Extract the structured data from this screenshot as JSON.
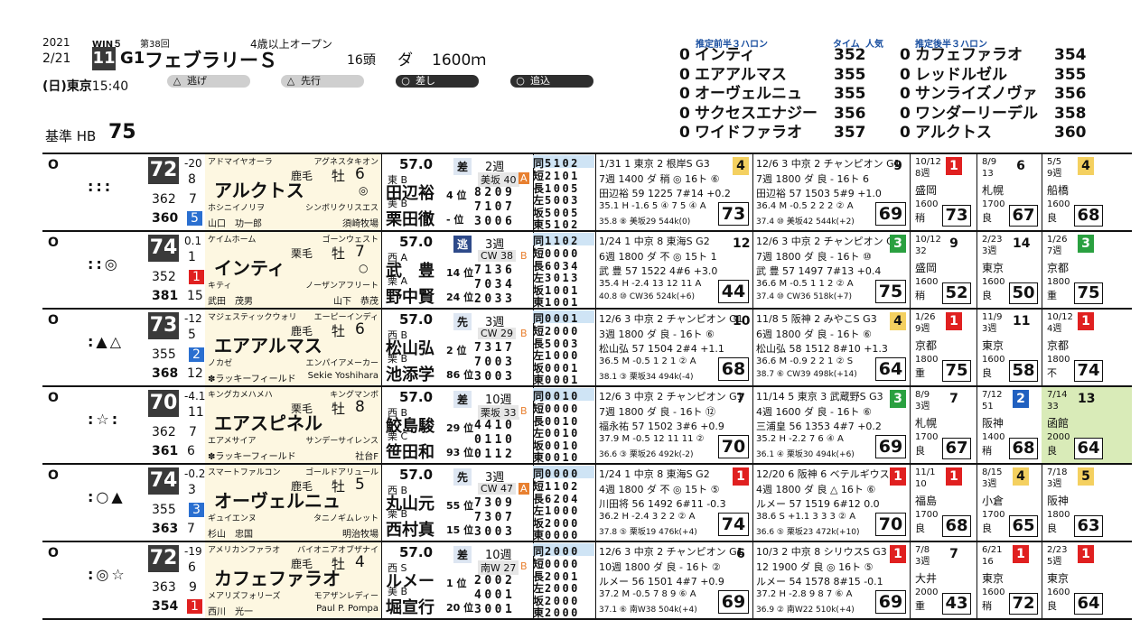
{
  "header": {
    "year": "2021",
    "date": "2/21",
    "day": "(日)",
    "venue": "東京",
    "time": "15:40",
    "win5": "WIN５",
    "kai": "第38回",
    "race_no": "11",
    "grade": "G1",
    "race_name": "フェブラリーＳ",
    "condition": "4歳以上オープン",
    "heads": "16頭",
    "surface": "ダ",
    "distance": "1600ｍ",
    "styles": [
      {
        "mark": "△",
        "label": "逃げ",
        "dark": false
      },
      {
        "mark": "△",
        "label": "先行",
        "dark": false
      },
      {
        "mark": "○",
        "label": "差し",
        "dark": true
      },
      {
        "mark": "○",
        "label": "追込",
        "dark": true
      }
    ],
    "base_label": "基準 HB",
    "base_value": "75"
  },
  "pre3f": {
    "title": "推定前半３ハロン",
    "col_time": "タイム",
    "col_pop": "人気",
    "items": [
      {
        "num": "0",
        "name": "インティ",
        "time": "352"
      },
      {
        "num": "0",
        "name": "エアアルマス",
        "time": "355"
      },
      {
        "num": "0",
        "name": "オーヴェルニュ",
        "time": "355"
      },
      {
        "num": "0",
        "name": "サクセスエナジー",
        "time": "356"
      },
      {
        "num": "0",
        "name": "ワイドファラオ",
        "time": "357"
      }
    ]
  },
  "post3f": {
    "title": "推定後半３ハロン",
    "items": [
      {
        "num": "0",
        "name": "カフェファラオ",
        "time": "354"
      },
      {
        "num": "0",
        "name": "レッドルゼル",
        "time": "355"
      },
      {
        "num": "0",
        "name": "サンライズノヴァ",
        "time": "356"
      },
      {
        "num": "0",
        "name": "ワンダーリーデル",
        "time": "358"
      },
      {
        "num": "0",
        "name": "アルクトス",
        "time": "360"
      }
    ]
  },
  "horses": [
    {
      "mark": "O",
      "pred": ":::",
      "idx": "72",
      "chg": "-20",
      "rank": "8",
      "hb1": "362",
      "hb1r": "7",
      "hb2": "360",
      "hb2r": "5",
      "hb2c": "blue",
      "sire": "アドマイヤオーラ",
      "bms": "アグネスタキオン",
      "coat": "鹿毛",
      "sex": "牡",
      "age": "6",
      "name": "アルクトス",
      "sym": "◎",
      "dam": "ホシニイノリヲ",
      "dam_sire": "シンボリクリスエス",
      "trainer": "山口　功一郎",
      "owner": "須崎牧場",
      "weight": "57.0",
      "style": "差",
      "style_hi": false,
      "j1_tag": "東 B",
      "j1": "田辺裕",
      "j1_rank": "4 位",
      "j2_tag": "美 B",
      "j2": "栗田徹",
      "j2_rank": "- 位",
      "weeks": "2週",
      "course": "美坂 40",
      "course_tag": "A",
      "d1": "8209",
      "d2": "7107",
      "d3": "3006",
      "stats": [
        [
          "同",
          "5102"
        ],
        [
          "短",
          "2101"
        ],
        [
          "長",
          "1005"
        ],
        [
          "左",
          "5003"
        ],
        [
          "坂",
          "5005"
        ],
        [
          "東",
          "5102"
        ]
      ],
      "r1": {
        "l1": "1/31 1 東京 2 根岸S G3",
        "l2": "7週 1400 ダ 稍 ◎ 16ト ⑥",
        "l3": "田辺裕 59 1225 7#14 +0.2",
        "l4": "35.1 H -1.6 5 ④ 7 5 ④ A",
        "l5": "35.8 ⑧ 美坂29 544k(0)",
        "idx": "73",
        "pl": "4",
        "plc": "y"
      },
      "r2": {
        "l1": "12/6 3 中京 2 チャンピオン G1",
        "l2": "7週 1800 ダ 良 - 16ト 6",
        "l3": "田辺裕 57 1503 5#9 +1.0",
        "l4": "36.4 M -0.5 2 2 2 ② A",
        "l5": "37.4 ⑩ 美坂42 544k(+2)",
        "idx": "69",
        "pl": "9",
        "plc": ""
      },
      "s1": {
        "date": "10/12",
        "w": "8週",
        "v": "盛岡",
        "d": "1600",
        "g": "稍",
        "p": "1",
        "pc": "r",
        "idx": "73"
      },
      "s2": {
        "date": "8/9",
        "w": "13",
        "v": "札幌",
        "d": "1700",
        "g": "良",
        "p": "6",
        "pc": "",
        "idx": "67"
      },
      "s3": {
        "date": "5/5",
        "w": "9週",
        "v": "船橋",
        "d": "1600",
        "g": "良",
        "p": "4",
        "pc": "y",
        "idx": "68"
      }
    },
    {
      "mark": "O",
      "pred": "::◎",
      "idx": "74",
      "chg": "0.1",
      "rank": "1",
      "rankc": "red",
      "hb1": "352",
      "hb1r": "1",
      "hb1c": "red",
      "hb2": "381",
      "hb2r": "15",
      "hb2c": "",
      "sire": "ケイムホーム",
      "bms": "ゴーンウェスト",
      "coat": "栗毛",
      "sex": "牡",
      "age": "7",
      "name": "インティ",
      "sym": "○",
      "dam": "キティ",
      "dam_sire": "ノーザンアフリート",
      "trainer": "武田　茂男",
      "owner": "山下　恭茂",
      "weight": "57.0",
      "style": "逃",
      "style_hi": true,
      "j1_tag": "西 A",
      "j1": "武　豊",
      "j1_rank": "14 位",
      "j2_tag": "栗 A",
      "j2": "野中賢",
      "j2_rank": "24 位",
      "weeks": "3週",
      "course": "CW 38",
      "course_tag": "B",
      "d1": "7136",
      "d2": "7034",
      "d3": "2033",
      "stats": [
        [
          "同",
          "1102"
        ],
        [
          "短",
          "0000"
        ],
        [
          "長",
          "6034"
        ],
        [
          "左",
          "3013"
        ],
        [
          "坂",
          "1001"
        ],
        [
          "東",
          "1001"
        ]
      ],
      "r1": {
        "l1": "1/24 1 中京 8 東海S G2",
        "l2": "6週 1800 ダ 不 ◎ 15ト 1",
        "l3": "武 豊 57 1522 4#6 +3.0",
        "l4": "35.4 H -2.4 13 12 11 A",
        "l5": "40.8 ⑩ CW36 524k(+6)",
        "idx": "44",
        "pl": "12",
        "plc": ""
      },
      "r2": {
        "l1": "12/6 3 中京 2 チャンピオン G1",
        "l2": "7週 1800 ダ 良 - 16ト ⑩",
        "l3": "武 豊 57 1497 7#13 +0.4",
        "l4": "36.6 M -0.5 1 1 2 ② A",
        "l5": "37.4 ⑩ CW36 518k(+7)",
        "idx": "75",
        "pl": "3",
        "plc": "g"
      },
      "s1": {
        "date": "10/12",
        "w": "32",
        "v": "盛岡",
        "d": "1600",
        "g": "稍",
        "p": "9",
        "pc": "",
        "idx": "52"
      },
      "s2": {
        "date": "2/23",
        "w": "3週",
        "v": "東京",
        "d": "1600",
        "g": "良",
        "p": "14",
        "pc": "",
        "idx": "50"
      },
      "s3": {
        "date": "1/26",
        "w": "7週",
        "v": "京都",
        "d": "1800",
        "g": "重",
        "p": "3",
        "pc": "g",
        "idx": "75"
      }
    },
    {
      "mark": "O",
      "pred": ":▲△",
      "idx": "73",
      "chg": "-12",
      "rank": "5",
      "rankc": "blue",
      "hb1": "355",
      "hb1r": "2",
      "hb1c": "blue",
      "hb2": "368",
      "hb2r": "12",
      "hb2c": "",
      "sire": "マジェスティックウォリ",
      "bms": "エーピーインディ",
      "coat": "鹿毛",
      "sex": "牡",
      "age": "6",
      "name": "エアアルマス",
      "sym": "",
      "dam": "ノカゼ",
      "dam_sire": "エンパイアメーカー",
      "trainer": "✽ラッキーフィールド",
      "owner": "Sekie Yoshihara",
      "weight": "57.0",
      "style": "先",
      "style_hi": false,
      "j1_tag": "西 B",
      "j1": "松山弘",
      "j1_rank": "2 位",
      "j2_tag": "栗 B",
      "j2": "池添学",
      "j2_rank": "86 位",
      "weeks": "3週",
      "course": "CW 29",
      "course_tag": "B",
      "d1": "7317",
      "d2": "7003",
      "d3": "3003",
      "stats": [
        [
          "同",
          "0001"
        ],
        [
          "短",
          "2000"
        ],
        [
          "長",
          "5003"
        ],
        [
          "左",
          "1000"
        ],
        [
          "坂",
          "0001"
        ],
        [
          "東",
          "0001"
        ]
      ],
      "r1": {
        "l1": "12/6 3 中京 2 チャンピオン G1",
        "l2": "3週 1800 ダ 良 - 16ト ⑥",
        "l3": "松山弘 57 1504 2#4 +1.1",
        "l4": "36.5 M -0.5 1 2 1 ② A",
        "l5": "38.1 ③ 栗坂34 494k(-4)",
        "idx": "68",
        "pl": "10",
        "plc": ""
      },
      "r2": {
        "l1": "11/8 5 阪神 2 みやこS G3",
        "l2": "6週 1800 ダ 良 - 16ト ⑥",
        "l3": "松山弘 58 1512 8#10 +1.3",
        "l4": "36.6 M -0.9 2 2 1 ② S",
        "l5": "38.7 ⑥ CW39 498k(+14)",
        "idx": "64",
        "pl": "4",
        "plc": "y"
      },
      "s1": {
        "date": "1/26",
        "w": "9週",
        "v": "京都",
        "d": "1800",
        "g": "重",
        "p": "1",
        "pc": "r",
        "idx": "75"
      },
      "s2": {
        "date": "11/9",
        "w": "3週",
        "v": "東京",
        "d": "1600",
        "g": "良",
        "p": "11",
        "pc": "",
        "idx": "58"
      },
      "s3": {
        "date": "10/12",
        "w": "4週",
        "v": "京都",
        "d": "1800",
        "g": "不",
        "p": "1",
        "pc": "r",
        "idx": "74"
      }
    },
    {
      "mark": "O",
      "pred": ":☆:",
      "idx": "70",
      "chg": "-4.1",
      "rank": "11",
      "rankc": "",
      "hb1": "362",
      "hb1r": "7",
      "hb1c": "",
      "hb2": "361",
      "hb2r": "6",
      "hb2c": "",
      "sire": "キングカメハメハ",
      "bms": "キングマンボ",
      "coat": "栗毛",
      "sex": "牡",
      "age": "8",
      "name": "エアスピネル",
      "sym": "",
      "dam": "エアメサイア",
      "dam_sire": "サンデーサイレンス",
      "trainer": "✽ラッキーフィールド",
      "owner": "社台F",
      "weight": "57.0",
      "style": "差",
      "style_hi": false,
      "j1_tag": "西 B",
      "j1": "鮫島駿",
      "j1_rank": "29 位",
      "j2_tag": "栗 C",
      "j2": "笹田和",
      "j2_rank": "93 位",
      "weeks": "10週",
      "course": "栗坂 33",
      "course_tag": "B",
      "d1": "4410",
      "d2": "0110",
      "d3": "0112",
      "stats": [
        [
          "同",
          "0010"
        ],
        [
          "短",
          "0000"
        ],
        [
          "長",
          "0010"
        ],
        [
          "左",
          "0010"
        ],
        [
          "坂",
          "0010"
        ],
        [
          "東",
          "0010"
        ]
      ],
      "r1": {
        "l1": "12/6 3 中京 2 チャンピオン G1",
        "l2": "7週 1800 ダ 良 - 16ト ⑫",
        "l3": "福永祐 57 1502 3#6 +0.9",
        "l4": "37.9 M -0.5 12 11 11 ②",
        "l5": "36.6 ③ 栗坂26 492k(-2)",
        "idx": "70",
        "pl": "7",
        "plc": ""
      },
      "r2": {
        "l1": "11/14 5 東京 3 武蔵野S G3",
        "l2": "4週 1600 ダ 良 - 16ト ⑥",
        "l3": "三浦皇 56 1353 4#7 +0.2",
        "l4": "35.2 H -2.2 7 6 ④ A",
        "l5": "36.1 ④ 栗坂30 494k(+6)",
        "idx": "69",
        "pl": "3",
        "plc": "g"
      },
      "s1": {
        "date": "8/9",
        "w": "3週",
        "v": "札幌",
        "d": "1700",
        "g": "良",
        "p": "7",
        "pc": "",
        "idx": "67"
      },
      "s2": {
        "date": "7/12",
        "w": "51",
        "v": "阪神",
        "d": "1400",
        "g": "稍",
        "p": "2",
        "pc": "b",
        "idx": "68"
      },
      "s3": {
        "date": "7/14",
        "w": "33",
        "v": "函館",
        "d": "2000",
        "g": "良",
        "p": "13",
        "pc": "",
        "idx": "64",
        "hl": true
      }
    },
    {
      "mark": "O",
      "pred": ":○▲",
      "idx": "74",
      "chg": "-0.2",
      "rank": "3",
      "rankc": "blue",
      "hb1": "355",
      "hb1r": "3",
      "hb1c": "blue",
      "hb2": "363",
      "hb2r": "7",
      "hb2c": "",
      "sire": "スマートファルコン",
      "bms": "ゴールドアリュール",
      "coat": "鹿毛",
      "sex": "牡",
      "age": "5",
      "name": "オーヴェルニュ",
      "sym": "",
      "dam": "ギュイエンヌ",
      "dam_sire": "タニノギムレット",
      "trainer": "杉山　忠国",
      "owner": "明治牧場",
      "weight": "57.0",
      "style": "先",
      "style_hi": false,
      "j1_tag": "西 B",
      "j1": "丸山元",
      "j1_rank": "55 位",
      "j2_tag": "栗 B",
      "j2": "西村真",
      "j2_rank": "15 位",
      "weeks": "3週",
      "course": "CW 47",
      "course_tag": "A",
      "d1": "7309",
      "d2": "7307",
      "d3": "3003",
      "stats": [
        [
          "同",
          "0000"
        ],
        [
          "短",
          "1102"
        ],
        [
          "長",
          "6204"
        ],
        [
          "左",
          "1000"
        ],
        [
          "坂",
          "2000"
        ],
        [
          "東",
          "0000"
        ]
      ],
      "r1": {
        "l1": "1/24 1 中京 8 東海S G2",
        "l2": "4週 1800 ダ 不 ◎ 15ト ⑤",
        "l3": "川田将 56 1492 6#11 -0.3",
        "l4": "36.2 H -2.4 3 2 2 ② A",
        "l5": "37.8 ⑤ 栗坂19 476k(+4)",
        "idx": "74",
        "pl": "1",
        "plc": "r"
      },
      "r2": {
        "l1": "12/20 6 阪神 6 ベテルギウス L",
        "l2": "4週 1800 ダ 良 △ 16ト ⑥",
        "l3": "ルメー 57 1519 6#12 0.0",
        "l4": "38.6 S +1.1 3 3 3 ② A",
        "l5": "36.6 ⑤ 栗坂23 472k(+10)",
        "idx": "70",
        "pl": "1",
        "plc": "r"
      },
      "s1": {
        "date": "11/1",
        "w": "10",
        "v": "福島",
        "d": "1700",
        "g": "良",
        "p": "1",
        "pc": "r",
        "idx": "68"
      },
      "s2": {
        "date": "8/15",
        "w": "3週",
        "v": "小倉",
        "d": "1700",
        "g": "良",
        "p": "4",
        "pc": "y",
        "idx": "65"
      },
      "s3": {
        "date": "7/18",
        "w": "3週",
        "v": "阪神",
        "d": "1800",
        "g": "良",
        "p": "5",
        "pc": "y",
        "idx": "63"
      }
    },
    {
      "mark": "O",
      "pred": ":◎☆",
      "idx": "72",
      "chg": "-19",
      "rank": "6",
      "rankc": "",
      "hb1": "363",
      "hb1r": "9",
      "hb1c": "",
      "hb2": "354",
      "hb2r": "1",
      "hb2c": "red",
      "sire": "アメリカンファラオ",
      "bms": "バイオニアオブザナイ",
      "coat": "鹿毛",
      "sex": "牡",
      "age": "4",
      "name": "カフェファラオ",
      "sym": "",
      "dam": "メアリズフォリーズ",
      "dam_sire": "モアザンレディー",
      "trainer": "西川　光一",
      "owner": "Paul P. Pompa",
      "weight": "57.0",
      "style": "差",
      "style_hi": false,
      "j1_tag": "西 S",
      "j1": "ルメー",
      "j1_rank": "1 位",
      "j2_tag": "美 B",
      "j2": "堀宣行",
      "j2_rank": "20 位",
      "weeks": "10週",
      "course": "南W 27",
      "course_tag": "B",
      "d1": "2002",
      "d2": "4001",
      "d3": "3001",
      "stats": [
        [
          "同",
          "2000"
        ],
        [
          "短",
          "0000"
        ],
        [
          "長",
          "2001"
        ],
        [
          "左",
          "2000"
        ],
        [
          "坂",
          "2000"
        ],
        [
          "東",
          "2000"
        ]
      ],
      "r1": {
        "l1": "12/6 3 中京 2 チャンピオン G1",
        "l2": "10週 1800 ダ 良 - 16ト ②",
        "l3": "ルメー 56 1501 4#7 +0.9",
        "l4": "37.2 M -0.5 7 8 9 ⑥ A",
        "l5": "37.1 ⑥ 南W38 504k(+4)",
        "idx": "69",
        "pl": "6",
        "plc": ""
      },
      "r2": {
        "l1": "10/3 2 中京 8 シリウスS G3",
        "l2": "12 1900 ダ 良 ◎ 16ト ⑤",
        "l3": "ルメー 54 1578 8#15 -0.1",
        "l4": "37.2 H -2.8 9 8 7 ⑥ A",
        "l5": "36.9 ② 南W22 510k(+4)",
        "idx": "69",
        "pl": "1",
        "plc": "r"
      },
      "s1": {
        "date": "7/8",
        "w": "3週",
        "v": "大井",
        "d": "2000",
        "g": "重",
        "p": "7",
        "pc": "",
        "idx": "43"
      },
      "s2": {
        "date": "6/21",
        "w": "16",
        "v": "東京",
        "d": "1600",
        "g": "稍",
        "p": "1",
        "pc": "r",
        "idx": "72"
      },
      "s3": {
        "date": "2/23",
        "w": "5週",
        "v": "東京",
        "d": "1600",
        "g": "良",
        "p": "1",
        "pc": "r",
        "idx": "64"
      }
    }
  ]
}
